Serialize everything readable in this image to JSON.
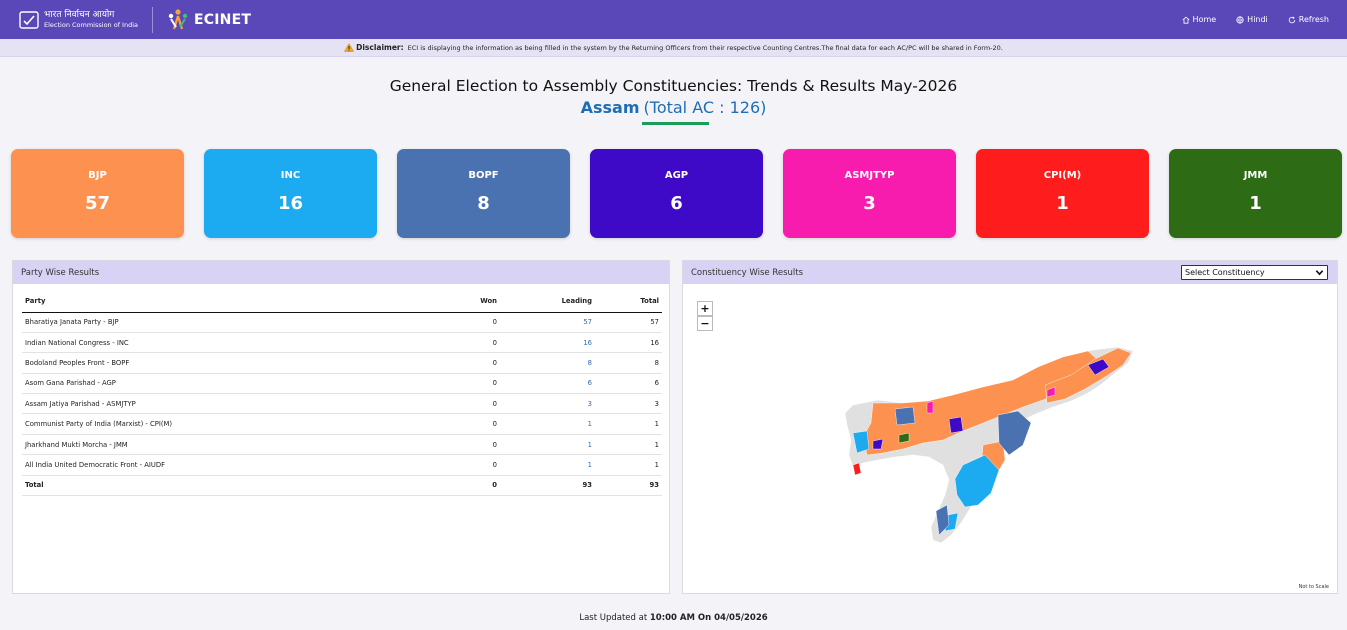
{
  "header": {
    "eci_line1": "भारत निर्वाचन आयोग",
    "eci_line2": "Election Commission of India",
    "app_name": "ECINET",
    "nav": [
      {
        "label": "Home",
        "icon": "home-icon"
      },
      {
        "label": "Hindi",
        "icon": "globe-icon"
      },
      {
        "label": "Refresh",
        "icon": "refresh-icon"
      }
    ]
  },
  "disclaimer": {
    "label": "Disclaimer:",
    "text": "ECI is displaying the information as being filled in the system by the Returning Officers from their respective Counting Centres.The final data for each AC/PC will be shared in Form-20."
  },
  "page": {
    "title": "General Election to Assembly Constituencies: Trends & Results May-2026",
    "state": "Assam",
    "total": "(Total AC : 126)"
  },
  "cards": [
    {
      "party": "BJP",
      "count": "57",
      "color": "#fd9250"
    },
    {
      "party": "INC",
      "count": "16",
      "color": "#1caaf0"
    },
    {
      "party": "BOPF",
      "count": "8",
      "color": "#4b72b0"
    },
    {
      "party": "AGP",
      "count": "6",
      "color": "#3e0ac7"
    },
    {
      "party": "ASMJTYP",
      "count": "3",
      "color": "#f81cae"
    },
    {
      "party": "CPI(M)",
      "count": "1",
      "color": "#ff1c1c"
    },
    {
      "party": "JMM",
      "count": "1",
      "color": "#2d6b15"
    }
  ],
  "party_panel": {
    "title": "Party Wise Results",
    "headers": [
      "Party",
      "Won",
      "Leading",
      "Total"
    ],
    "rows": [
      [
        "Bharatiya Janata Party - BJP",
        "0",
        "57",
        "57"
      ],
      [
        "Indian National Congress - INC",
        "0",
        "16",
        "16"
      ],
      [
        "Bodoland Peoples Front - BOPF",
        "0",
        "8",
        "8"
      ],
      [
        "Asom Gana Parishad - AGP",
        "0",
        "6",
        "6"
      ],
      [
        "Assam Jatiya Parishad - ASMJTYP",
        "0",
        "3",
        "3"
      ],
      [
        "Communist Party of India (Marxist) - CPI(M)",
        "0",
        "1",
        "1"
      ],
      [
        "Jharkhand Mukti Morcha - JMM",
        "0",
        "1",
        "1"
      ],
      [
        "All India United Democratic Front - AIUDF",
        "0",
        "1",
        "1"
      ]
    ],
    "total_row": [
      "Total",
      "0",
      "93",
      "93"
    ]
  },
  "map_panel": {
    "title": "Constituency Wise Results",
    "select_value": "Select Constituency",
    "zoom_in": "+",
    "zoom_out": "−",
    "note": "Not to Scale"
  },
  "footer": {
    "prefix": "Last Updated at",
    "time": "10:00 AM On 04/05/2026"
  }
}
